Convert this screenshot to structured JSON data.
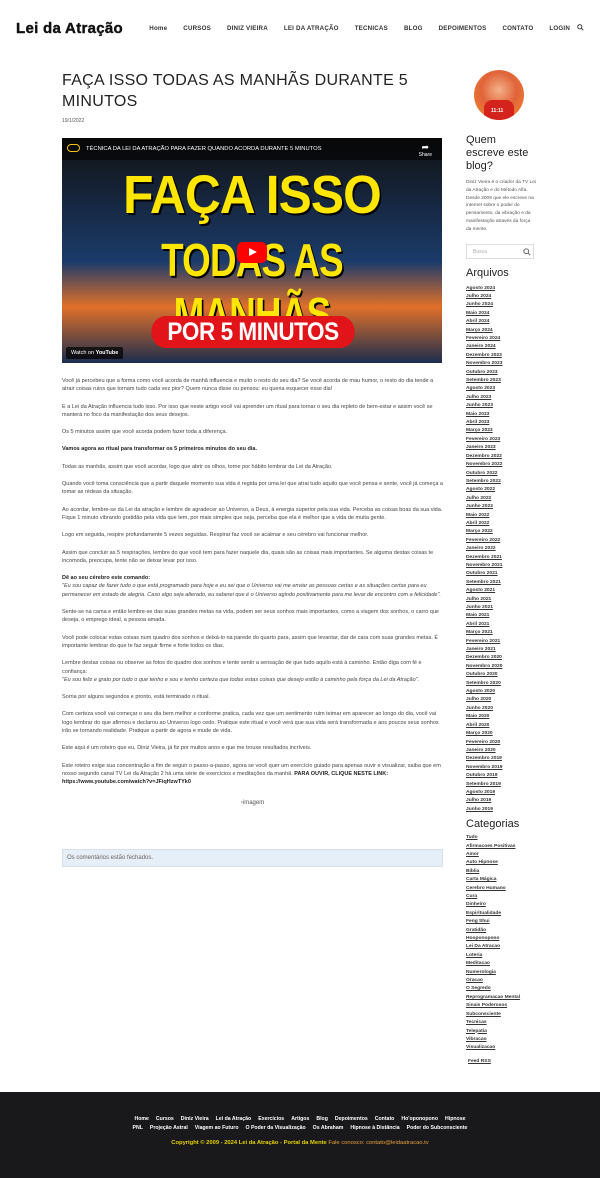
{
  "header": {
    "logo": "Lei da Atração",
    "nav": [
      "Home",
      "CURSOS",
      "DINIZ VIEIRA",
      "LEI DA ATRAÇÃO",
      "TECNICAS",
      "BLOG",
      "DEPOIMENTOS",
      "CONTATO",
      "LOGIN"
    ]
  },
  "article": {
    "title": "FAÇA ISSO TODAS AS MANHÃS DURANTE 5 MINUTOS",
    "date": "19/1/2022",
    "video": {
      "top_title": "TÉCNICA DA LEI DA ATRAÇÃO PARA FAZER QUANDO ACORDA DURANTE 5 MINUTOS",
      "share": "Share",
      "line1": "FAÇA ISSO",
      "line2": "TODAS AS MANHÃS",
      "banner": "POR 5 MINUTOS",
      "watch_on": "Watch on",
      "youtube": "YouTube"
    },
    "paragraphs": [
      "Você já percebeu que a forma como você acorda de manhã influencia e muito o resto do seu dia? Se você acorda de mau humor, o resto do dia tende a atrair coisas ruins que tornam tudo cada vez pior? Quem nunca disse ou pensou: eu queria esquecer esse dia!",
      "E a Lei da Atração influencia tudo isso. Por isso que neste artigo você vai aprender um ritual para tornar o seu dia repleto de bem-estar e assim você se manterá no foco da manifestação dos seus desejos.",
      "Os 5 minutos assim que você acorda podem fazer toda a diferença."
    ],
    "bold_1": "Vamos agora ao ritual para transformar os 5 primeiros minutos do seu dia.",
    "paragraphs_2": [
      "Todas as manhãs, assim que você acordar, logo que abrir os olhos, torne por hábito lembrar da Lei da Atração.",
      "Quando você toma consciência que a partir daquele momento sua vida é regida por uma lei que atrai tudo aquilo que você pensa e sente, você já começa a tomar as rédeas da situação.",
      "Ao acordar, lembre-se da Lei da atração e lembre de agradecer ao Universo, a Deus, à energia superior pela sua vida. Perceba as coisas boas da sua vida. Fique 1 minuto vibrando gratidão pela vida que tem, por mais simples que seja, perceba que ela é melhor que a vida de muita gente.",
      "Logo em seguida, respire profundamente 5 vezes seguidas. Respirar faz você se acalmar e seu cérebro vai funcionar melhor.",
      "Assim que concluir as 5 respirações, lembre do que você tem para fazer naquele dia, quais são as coisas mais importantes. Se alguma destas coisas te incomoda, preocupa, tente não se deixar levar por isso."
    ],
    "bold_2": "Dê ao seu cérebro este comando:",
    "italic_1": "\"Eu sou capaz de fazer tudo o que está programado para hoje e eu sei que o Universo vai me enviar as pessoas certas e as situações certas para eu permanecer em estado de alegria. Caso algo seja alterado, eu saberei que é o Universo agindo positivamente para me levar de encontro com a felicidade\".",
    "paragraphs_3": [
      "Sente-se na cama e então lembre-se das suas grandes metas na vida, podem ser seus sonhos mais importantes, como a viagem dos sonhos, o carro que deseja, o emprego ideal, a pessoa amada.",
      "Você pode colocar estas coisas num quadro dos sonhos e deixá-lo na parede do quarto para, assim que levantar, dar de cara com suas grandes metas. É importante lembrar do que te faz seguir firme e forte todos os dias."
    ],
    "lead_4": "Lembre destas coisas ou observe as fotos do quadro dos sonhos e tente sentir a sensação de que tudo aquilo está à caminho. Então diga com fé e confiança:",
    "italic_2": "\"Eu sou feliz e grato por tudo o que tenho e sou e tenho certeza que todas estas coisas que desejo estão à caminho pela força da Lei da Atração\".",
    "paragraphs_5": [
      "Sorria por alguns segundos e pronto, está terminado o ritual.",
      "Com certeza você vai começar o seu dia bem melhor e conforme pratica, cada vez que um sentimento ruim teimar em aparecer ao longo do dia, você vai logo lembrar do que afirmou e declarou ao Universo logo cedo. Pratique este ritual e você verá que sua vida será transformada e aos poucos seus sonhos irão se tornando realidade. Pratique a partir de agora e mude de vida.",
      "Este aqui é um roteiro que eu, Diniz Vieira, já fiz por muitos anos e que me trouxe resultados incríveis."
    ],
    "last_para": "Este roteiro exige sua concentração a fim de seguir o passo-a-passo, agora se você quer um exercício guiado para apenas ouvir e visualizar, saiba que em nosso segundo canal TV Lei da Atração 2 há uma série de exercícios e meditações da manhã.",
    "last_bold": "PARA OUVIR, CLIQUE NESTE LINK: https://www.youtube.com/watch?v=JFiqHzwTYk0",
    "image_alt": "imagem",
    "comments": "Os comentários estão fechados."
  },
  "sidebar": {
    "avatar_tag": "11:11",
    "about_title": "Quem escreve este blog?",
    "about_text": "Diniz Vieira é o criador da TV Lei da Atração e do Método Alfa. Desde 2009 que ele escreve na internet sobre o poder do pensamento, da vibração e da manifestação através da força da mente.",
    "search_placeholder": "Busca",
    "archives_title": "Arquivos",
    "archives": [
      "Agosto 2024",
      "Julho 2024",
      "Junho 2024",
      "Maio 2024",
      "Abril 2024",
      "Março 2024",
      "Fevereiro 2024",
      "Janeiro 2024",
      "Dezembro 2023",
      "Novembro 2023",
      "Outubro 2023",
      "Setembro 2023",
      "Agosto 2023",
      "Julho 2023",
      "Junho 2023",
      "Maio 2023",
      "Abril 2023",
      "Março 2023",
      "Fevereiro 2023",
      "Janeiro 2023",
      "Dezembro 2022",
      "Novembro 2022",
      "Outubro 2022",
      "Setembro 2022",
      "Agosto 2022",
      "Julho 2022",
      "Junho 2022",
      "Maio 2022",
      "Abril 2022",
      "Março 2022",
      "Fevereiro 2022",
      "Janeiro 2022",
      "Dezembro 2021",
      "Novembro 2021",
      "Outubro 2021",
      "Setembro 2021",
      "Agosto 2021",
      "Julho 2021",
      "Junho 2021",
      "Maio 2021",
      "Abril 2021",
      "Março 2021",
      "Fevereiro 2021",
      "Janeiro 2021",
      "Dezembro 2020",
      "Novembro 2020",
      "Outubro 2020",
      "Setembro 2020",
      "Agosto 2020",
      "Julho 2020",
      "Junho 2020",
      "Maio 2020",
      "Abril 2020",
      "Março 2020",
      "Fevereiro 2020",
      "Janeiro 2020",
      "Dezembro 2019",
      "Novembro 2019",
      "Outubro 2019",
      "Setembro 2019",
      "Agosto 2019",
      "Julho 2019",
      "Junho 2019"
    ],
    "categories_title": "Categorias",
    "categories": [
      "Tudo",
      "Afirmacoes Positivas",
      "Amor",
      "Auto Hipnose",
      "Bíblia",
      "Carta Mágica",
      "Cerebro Humano",
      "Cura",
      "Dinheiro",
      "Espiritualidade",
      "Feng Shui",
      "Gratidão",
      "Hooponopono",
      "Lei Da Atracao",
      "Loteria",
      "Meditacao",
      "Numerologia",
      "Oracao",
      "O Segredo",
      "Reprogramacao Mental",
      "Sinais Poderosos",
      "Subconsciente",
      "Tecnicas",
      "Telepatia",
      "Vibracao",
      "Visualizacao"
    ],
    "feed": "Feed RSS"
  },
  "footer": {
    "row1": [
      "Home",
      "Cursos",
      "Diniz Vieira",
      "Lei da Atração",
      "Exercícios",
      "Artigos",
      "Blog",
      "Depoimentos",
      "Contato",
      "Ho'oponopono",
      "Hipnose"
    ],
    "row2": [
      "PNL",
      "Projeção Astral",
      "Viagem ao Futuro",
      "O Poder da Visualização",
      "Os Abraham",
      "Hipnose à Distância",
      "Poder do Subconsciente"
    ],
    "copyright": "Copyright © 2009 - 2024 Lei da Atração - Portal da Mente",
    "contact": " Fale conosco: contato@leidaatracao.tv"
  }
}
